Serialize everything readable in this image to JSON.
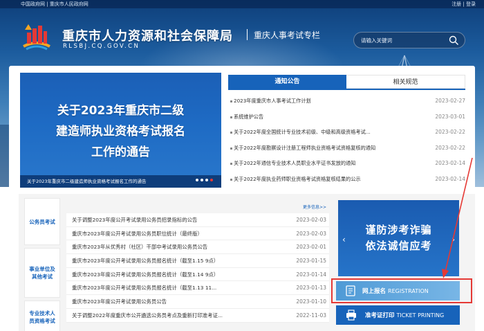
{
  "topbar": {
    "left_links": "中国政府网 | 重庆市人民政府网",
    "right_links": "注册 | 登录"
  },
  "header": {
    "title": "重庆市人力资源和社会保障局",
    "domain": "RLSBJ.CQ.GOV.CN",
    "subtitle": "重庆人事考试专栏",
    "search_placeholder": "请输入关键词"
  },
  "banner": {
    "title_line1": "关于2023年重庆市二级",
    "title_line2": "建造师执业资格考试报名",
    "title_line3": "工作的通告",
    "caption": "关于2023年重庆市二级建造师执业资格考试报名工作的通告"
  },
  "tabs": [
    "通知公告",
    "相关规范"
  ],
  "notices": [
    {
      "title": "2023年度重庆市人事考试工作计划",
      "date": "2023-02-27"
    },
    {
      "title": "系统维护公告",
      "date": "2023-03-01"
    },
    {
      "title": "关于2022年度全国统计专业技术初级、中级和高级资格考试...",
      "date": "2023-02-22"
    },
    {
      "title": "关于2022年度勘察设计注册工程师执业资格考试资格复核的通知",
      "date": "2023-02-22"
    },
    {
      "title": "关于2022年通信专业技术人员职业水平证书发放的通知",
      "date": "2023-02-14"
    },
    {
      "title": "关于2022年度执业药师职业资格考试资格复核结果的公示",
      "date": "2023-02-14"
    }
  ],
  "categories": [
    "公务员考试",
    "事业单位及其他考试",
    "专业技术人员资格考试"
  ],
  "more_label": "更多信息>>",
  "exam_list": [
    {
      "title": "关于调整2023年度公开考试录用公务员招录指标的公告",
      "date": "2023-02-03"
    },
    {
      "title": "重庆市2023年度公开考试录用公务员职位统计（最终版）",
      "date": "2023-02-03"
    },
    {
      "title": "重庆市2023年从优秀村（社区）干部中考试录用公务员公告",
      "date": "2023-02-01"
    },
    {
      "title": "重庆市2023年度公开考试录用公务员报名统计（截至1.15 9点）",
      "date": "2023-01-15"
    },
    {
      "title": "重庆市2023年度公开考试录用公务员报名统计（截至1.14 9点）",
      "date": "2023-01-14"
    },
    {
      "title": "重庆市2023年度公开考试录用公务员报名统计（截至1.13 11...",
      "date": "2023-01-13"
    },
    {
      "title": "重庆市2023年度公开考试录用公务员公告",
      "date": "2023-01-10"
    },
    {
      "title": "关于调整2022年度重庆市公开遴选公务员考点及重新打印准考证...",
      "date": "2022-11-03"
    }
  ],
  "fraud_banner": {
    "line1": "谨防涉考诈骗",
    "line2": "依法诚信应考"
  },
  "register_button": {
    "cn": "网上报名",
    "en": "REGISTRATION"
  },
  "print_button": {
    "cn": "准考证打印",
    "en": "TICKET PRINTING"
  },
  "colors": {
    "primary": "#1763ba",
    "accent_red": "#e53935"
  }
}
